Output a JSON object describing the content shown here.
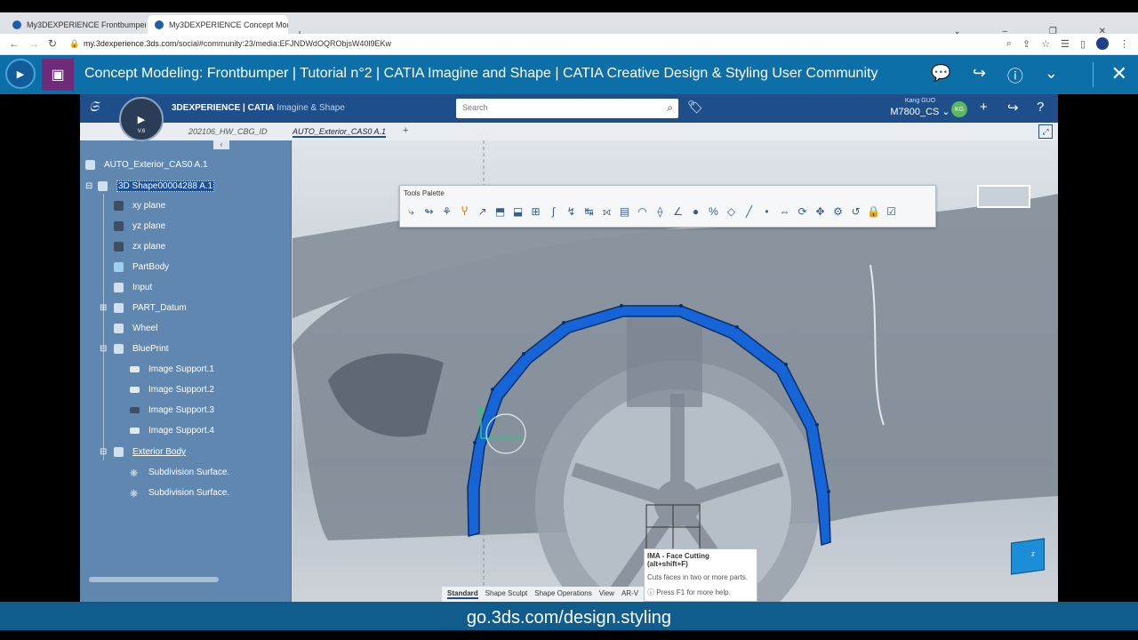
{
  "browser": {
    "tabs": [
      {
        "title": "My3DEXPERIENCE Frontbumper"
      },
      {
        "title": "My3DEXPERIENCE Concept Mod"
      }
    ],
    "url_host": "my.3dexperience.3ds.com",
    "url_path": "/social#community:23/media:EFJNDWdOQRObjsW40l9EKw"
  },
  "media_header": {
    "title": "Concept Modeling: Frontbumper | Tutorial n°2 | CATIA Imagine and Shape | CATIA Creative Design & Styling User Community"
  },
  "app": {
    "brand_bold": "3DEXPERIENCE | CATIA",
    "brand_light": "Imagine & Shape",
    "search_placeholder": "Search",
    "user_name": "Kang GUO",
    "user_role": "M7800_CS",
    "avatar_initials": "KG",
    "compass_version": "V.6",
    "tabs": [
      {
        "label": "202106_HW_CBG_ID"
      },
      {
        "label": "AUTO_Exterior_CAS0 A.1"
      }
    ]
  },
  "tree": {
    "nodes": [
      {
        "label": "AUTO_Exterior_CAS0 A.1"
      },
      {
        "label": "3D Shape00004288 A.1"
      },
      {
        "label": "xy plane"
      },
      {
        "label": "yz plane"
      },
      {
        "label": "zx plane"
      },
      {
        "label": "PartBody"
      },
      {
        "label": "Input"
      },
      {
        "label": "PART_Datum"
      },
      {
        "label": "Wheel"
      },
      {
        "label": "BluePrint"
      },
      {
        "label": "Image Support.1"
      },
      {
        "label": "Image Support.2"
      },
      {
        "label": "Image Support.3"
      },
      {
        "label": "Image Support.4"
      },
      {
        "label": "Exterior Body"
      },
      {
        "label": "Subdivision Surface."
      },
      {
        "label": "Subdivision Surface."
      }
    ]
  },
  "palette": {
    "title": "Tools Palette"
  },
  "tooltip": {
    "title": "IMA - Face Cutting",
    "shortcut": "(alt+shift+F)",
    "desc": "Cuts faces in two or more parts.",
    "help": "Press F1 for more help."
  },
  "action_bar": {
    "tabs": [
      "Standard",
      "Shape Sculpt",
      "Shape Operations",
      "View",
      "AR-V"
    ]
  },
  "banner": {
    "text": "go.3ds.com/design.styling"
  },
  "colors": {
    "header_blue": "#0c6fa8",
    "app_blue": "#1e4f8a",
    "tree_blue": "#5f87b0",
    "edge_blue": "#1565d8",
    "banner_blue": "#0f5c8d"
  }
}
